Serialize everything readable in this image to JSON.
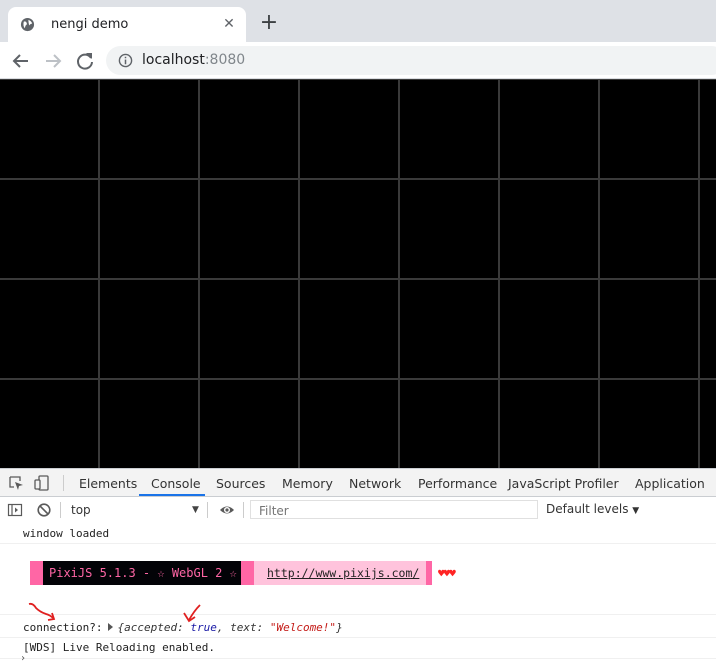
{
  "browser": {
    "tab_title": "nengi demo",
    "url_host": "localhost",
    "url_port": ":8080"
  },
  "devtools": {
    "tabs": [
      "Elements",
      "Console",
      "Sources",
      "Memory",
      "Network",
      "Performance",
      "JavaScript Profiler",
      "Application"
    ],
    "active_tab": "Console",
    "context": "top",
    "filter_placeholder": "Filter",
    "levels": "Default levels",
    "accent": "#1a73e8"
  },
  "console": {
    "line1": "window loaded",
    "pixi_banner": "PixiJS 5.1.3 - ☆ WebGL 2 ☆",
    "pixi_url": "http://www.pixijs.com/",
    "hearts": "♥♥♥",
    "conn_label": "connection?:",
    "obj_open": "{accepted: ",
    "obj_accepted": "true",
    "obj_mid": ", text: ",
    "obj_text": "\"Welcome!\"",
    "obj_close": "}",
    "wds": "[WDS] Live Reloading enabled.",
    "prompt": "›"
  },
  "colors": {
    "canvas_bg": "#000000",
    "grid_line": "#3a3a3a",
    "pixi_pink": "#ff66a5",
    "pixi_light": "#ffc3dc",
    "annotation_red": "#e02020"
  }
}
